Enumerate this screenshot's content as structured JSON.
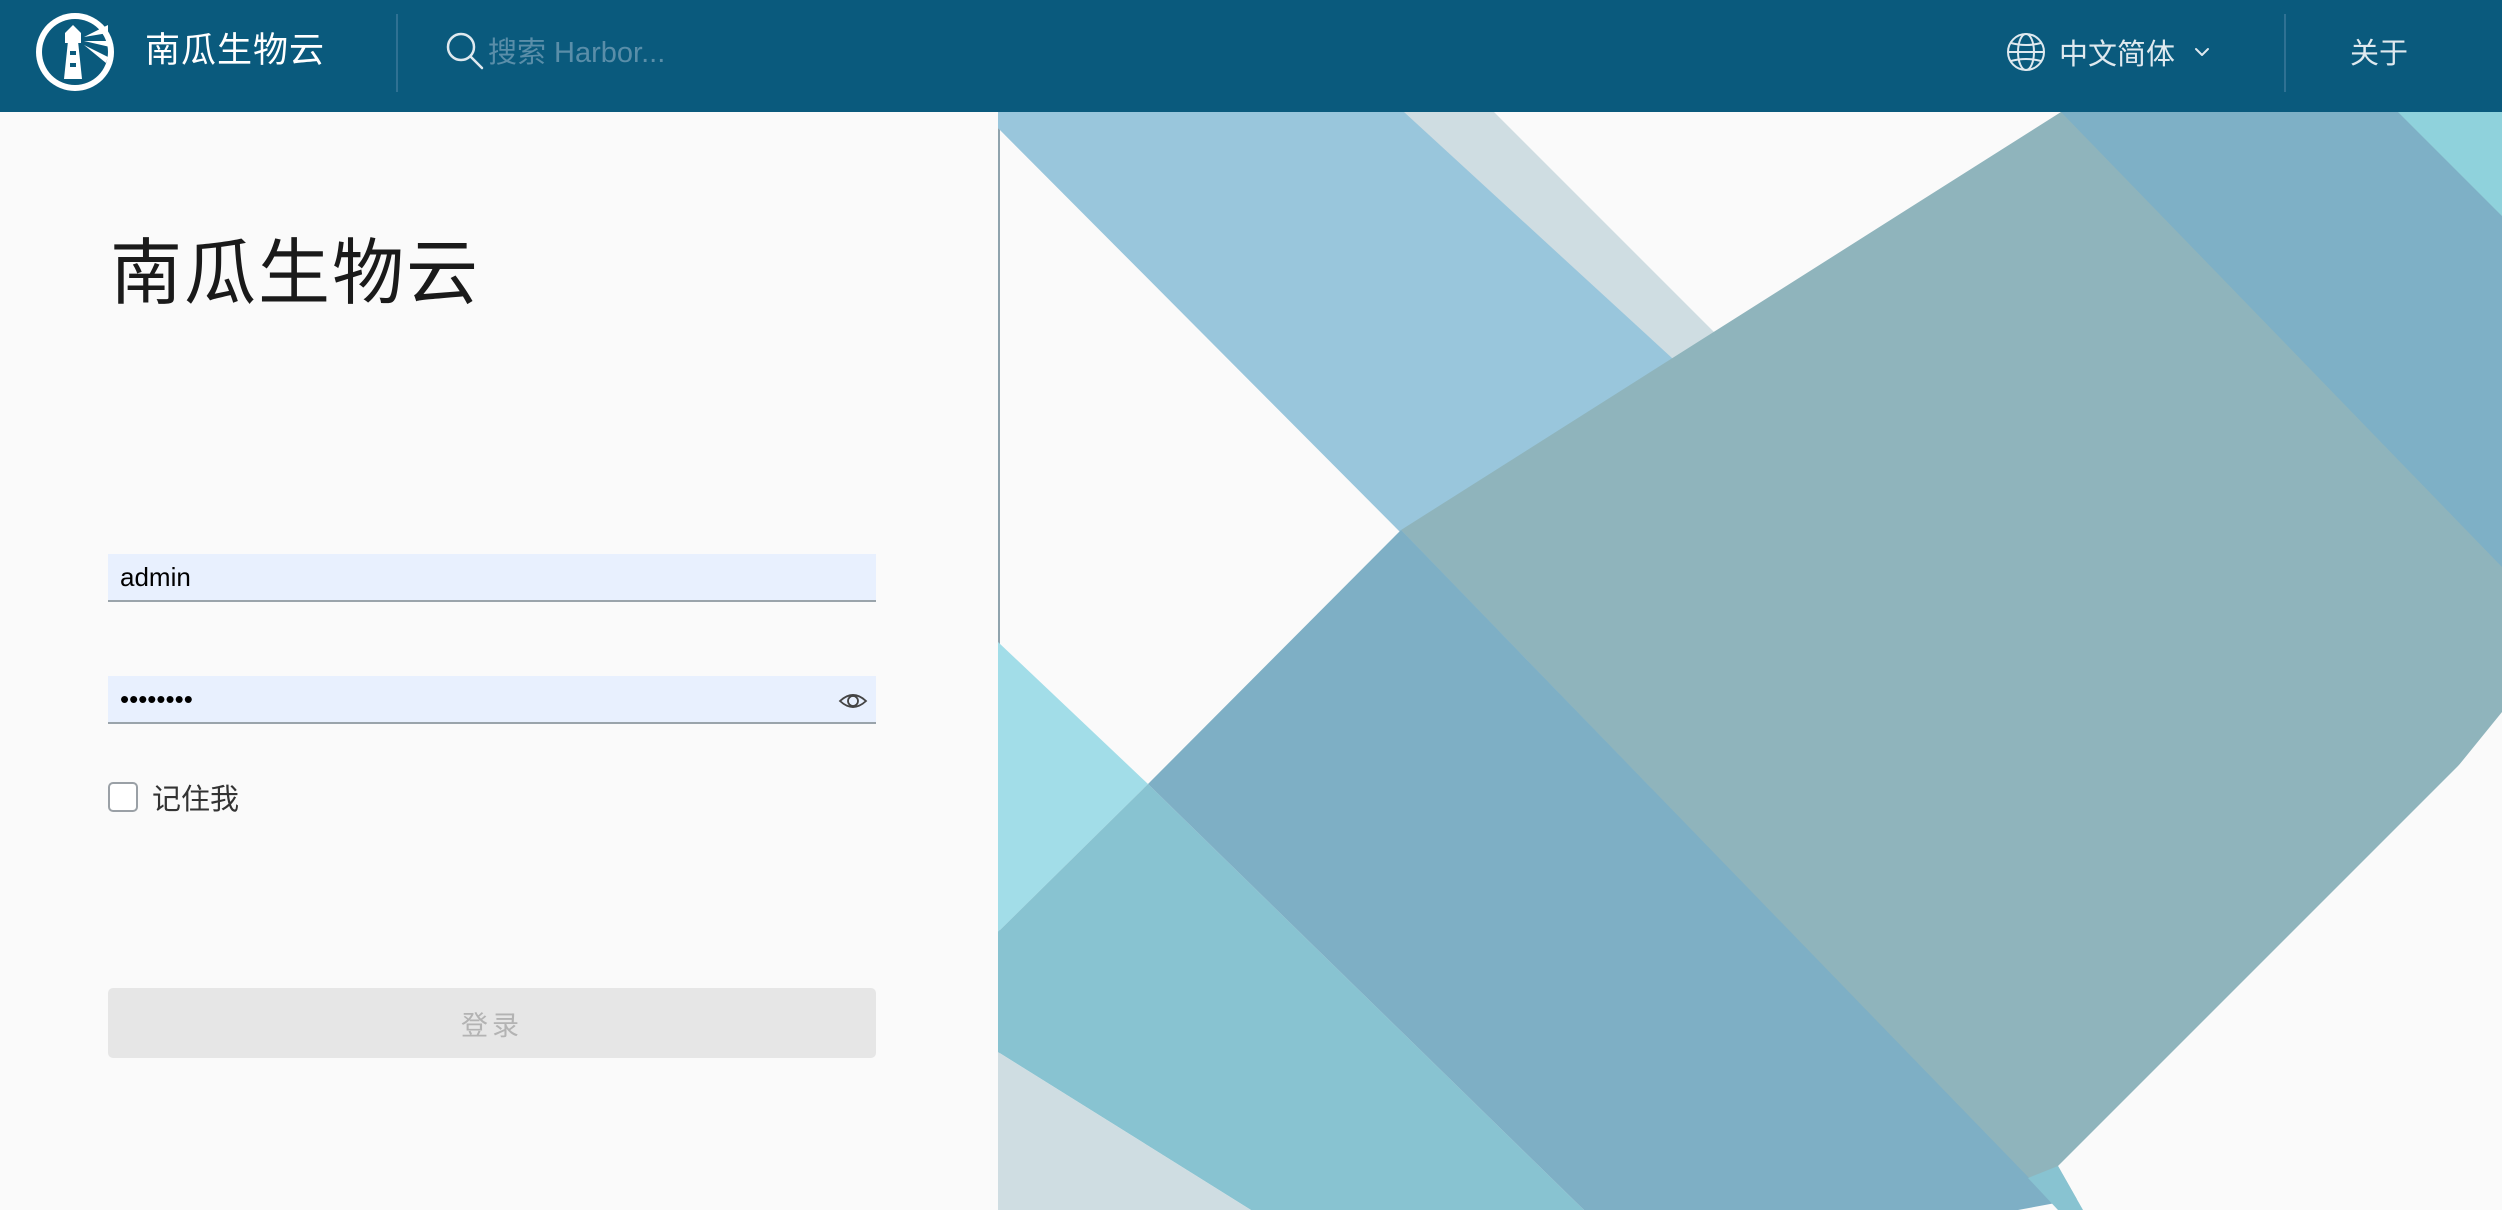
{
  "header": {
    "brand": "南瓜生物云",
    "search_placeholder": "搜索 Harbor...",
    "language": "中文简体",
    "about": "关于",
    "background_color": "#0a5a7d"
  },
  "login": {
    "title": "南瓜生物云",
    "username_value": "admin",
    "password_value": "admin123",
    "remember_label": "记住我",
    "remember_checked": false,
    "login_button": "登录",
    "input_bg_color": "#e8f0fe"
  },
  "icons": {
    "logo": "harbor-lighthouse-icon",
    "search": "search-icon",
    "globe": "globe-icon",
    "chevron": "chevron-down-icon",
    "eye": "eye-icon"
  }
}
